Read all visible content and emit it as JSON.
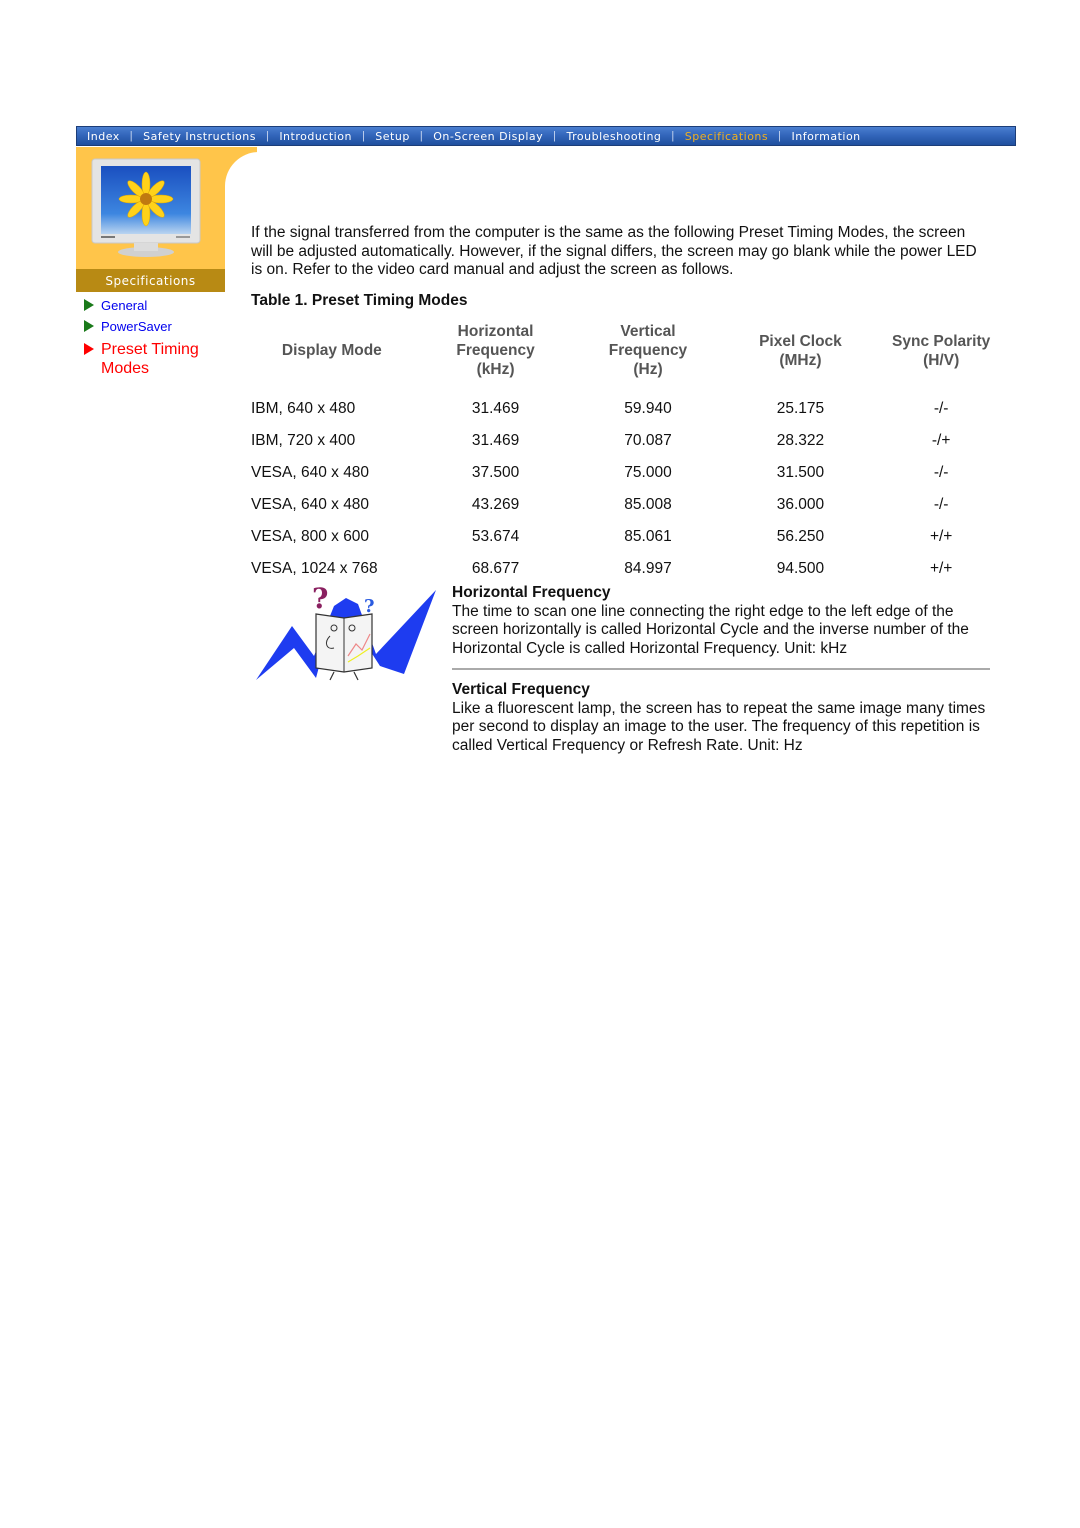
{
  "nav": {
    "items": [
      {
        "label": "Index",
        "active": false
      },
      {
        "label": "Safety Instructions",
        "active": false
      },
      {
        "label": "Introduction",
        "active": false
      },
      {
        "label": "Setup",
        "active": false
      },
      {
        "label": "On-Screen Display",
        "active": false
      },
      {
        "label": "Troubleshooting",
        "active": false
      },
      {
        "label": "Specifications",
        "active": true
      },
      {
        "label": "Information",
        "active": false
      }
    ],
    "colors": {
      "bar": "#3366bb",
      "active_text": "#f0b020",
      "text": "#ffffff"
    }
  },
  "side_panel": {
    "section_label": "Specifications",
    "image_icon": "monitor-with-flower-icon",
    "colors": {
      "panel": "#ffc54a",
      "label_bg": "#b88a14"
    }
  },
  "side_nav": {
    "items": [
      {
        "label": "General",
        "active": false
      },
      {
        "label": "PowerSaver",
        "active": false
      },
      {
        "label": "Preset Timing Modes",
        "active": true
      }
    ]
  },
  "main": {
    "intro": "If the signal transferred from the computer is the same as the following Preset Timing Modes, the screen will be adjusted automatically. However, if the signal differs, the screen may go blank while the power LED is on. Refer to the video card manual and adjust the screen as follows.",
    "table_title": "Table 1. Preset Timing Modes",
    "table": {
      "headers": [
        [
          "Display Mode"
        ],
        [
          "Horizontal",
          "Frequency",
          "(kHz)"
        ],
        [
          "Vertical",
          "Frequency",
          "(Hz)"
        ],
        [
          "Pixel Clock",
          "(MHz)"
        ],
        [
          "Sync Polarity",
          "(H/V)"
        ]
      ],
      "rows": [
        [
          "IBM, 640 x 480",
          "31.469",
          "59.940",
          "25.175",
          "-/-"
        ],
        [
          "IBM, 720 x 400",
          "31.469",
          "70.087",
          "28.322",
          "-/+"
        ],
        [
          "VESA, 640 x 480",
          "37.500",
          "75.000",
          "31.500",
          "-/-"
        ],
        [
          "VESA, 640 x 480",
          "43.269",
          "85.008",
          "36.000",
          "-/-"
        ],
        [
          "VESA, 800 x 600",
          "53.674",
          "85.061",
          "56.250",
          "+/+"
        ],
        [
          "VESA, 1024 x 768",
          "68.677",
          "84.997",
          "94.500",
          "+/+"
        ]
      ]
    },
    "illustration_icon": "confused-book-character-icon",
    "definitions": [
      {
        "title": "Horizontal Frequency",
        "text": "The time to scan one line connecting the right edge to the left edge of the screen horizontally is called Horizontal Cycle and the inverse number of the Horizontal Cycle is called Horizontal Frequency. Unit: kHz"
      },
      {
        "title": "Vertical Frequency",
        "text": "Like a fluorescent lamp, the screen has to repeat the same image many times per second to display an image to the user. The frequency of this repetition is called Vertical Frequency or Refresh Rate. Unit: Hz"
      }
    ]
  }
}
